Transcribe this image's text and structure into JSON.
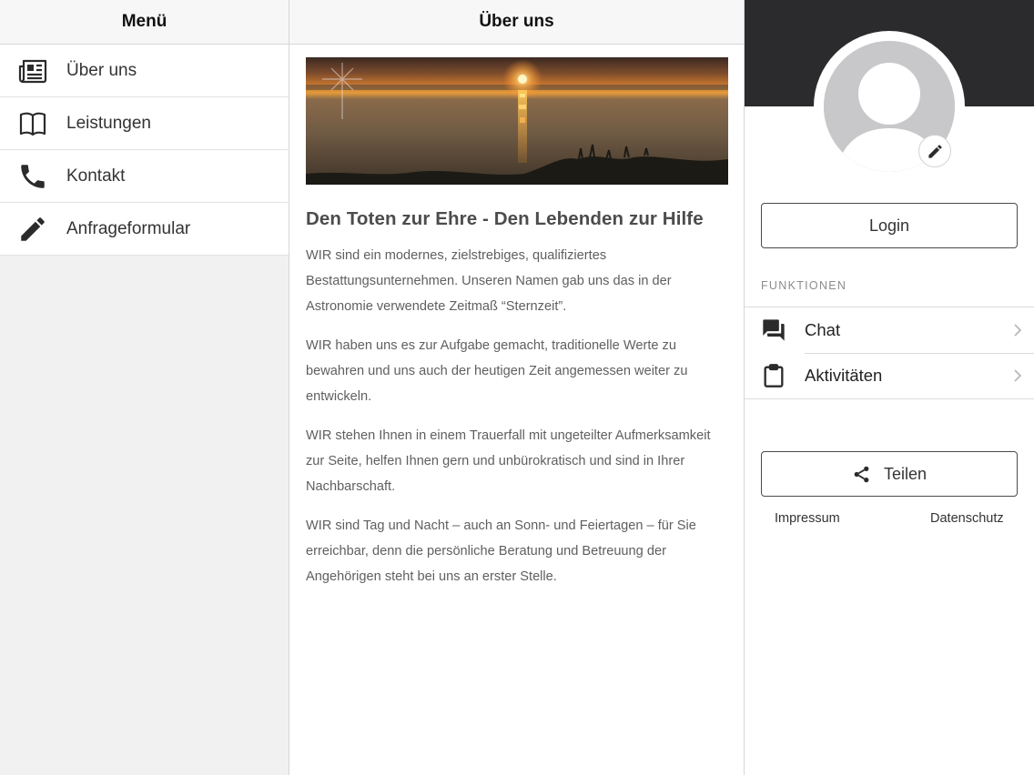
{
  "menu": {
    "title": "Menü",
    "items": [
      {
        "label": "Über uns",
        "icon": "newspaper-icon"
      },
      {
        "label": "Leistungen",
        "icon": "book-open-icon"
      },
      {
        "label": "Kontakt",
        "icon": "phone-icon"
      },
      {
        "label": "Anfrageformular",
        "icon": "pencil-icon"
      }
    ]
  },
  "content": {
    "title": "Über uns",
    "heading": "Den Toten zur Ehre - Den Lebenden zur Hilfe",
    "paragraphs": [
      "WIR sind ein modernes, zielstrebiges, qualifiziertes Bestattungsunternehmen. Unseren Namen gab uns das in der Astronomie verwendete Zeitmaß “Sternzeit”.",
      "WIR haben uns es zur Aufgabe gemacht, traditionelle Werte zu bewahren und uns auch der heutigen Zeit angemessen weiter zu entwickeln.",
      "WIR stehen Ihnen in einem Trauerfall mit ungeteilter Aufmerksamkeit zur Seite, helfen Ihnen gern und unbürokratisch und sind in Ihrer Nachbarschaft.",
      "WIR sind Tag und Nacht – auch an Sonn- und Feiertagen – für Sie erreichbar, denn die persönliche Beratung und Betreuung der Angehörigen steht bei uns an erster Stelle."
    ]
  },
  "account": {
    "login_label": "Login",
    "section_label": "FUNKTIONEN",
    "functions": [
      {
        "label": "Chat",
        "icon": "chat-icon"
      },
      {
        "label": "Aktivitäten",
        "icon": "clipboard-icon"
      }
    ],
    "share_label": "Teilen",
    "impressum_label": "Impressum",
    "datenschutz_label": "Datenschutz"
  },
  "colors": {
    "banner": "#2b2b2d",
    "pane_background": "#f1f1f2",
    "text_muted": "#5f5f5f"
  }
}
